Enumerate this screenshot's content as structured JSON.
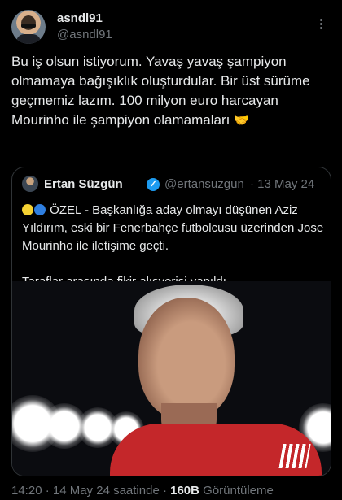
{
  "author": {
    "name": "asndl91",
    "handle": "@asndl91"
  },
  "tweet": {
    "text": "Bu iş olsun istiyorum. Yavaş yavaş şampiyon olmamaya bağışıklık oluşturdular. Bir üst sürüme geçmemiz lazım. 100 milyon euro harcayan Mourinho ile şampiyon olamamaları",
    "emoji": "handshake-icon"
  },
  "quoted": {
    "name": "Ertan Süzgün",
    "handle": "@ertansuzgun",
    "date": "· 13 May 24",
    "body_line1": "ÖZEL - Başkanlığa aday olmayı düşünen Aziz Yıldırım, eski bir Fenerbahçe futbolcusu üzerinden Jose Mourinho ile iletişime geçti.",
    "body_line2": "Taraflar arasında fikir alışverişi yapıldı.",
    "image_icon": "photo-of-man-icon"
  },
  "meta": {
    "time": "14:20 · 14 May 24 saatinde · ",
    "views_count": "160B",
    "views_label": " Görüntüleme"
  },
  "colors": {
    "background": "#000000",
    "text": "#e7e9ea",
    "muted": "#71767b",
    "verified": "#1d9bf0",
    "border": "#2f3336"
  }
}
